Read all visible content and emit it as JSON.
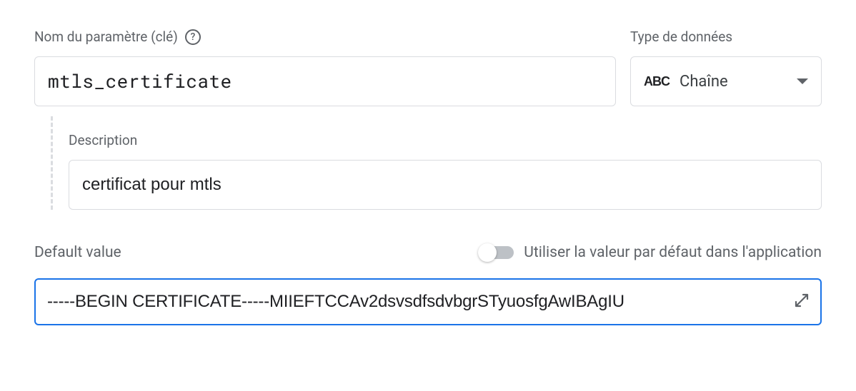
{
  "param": {
    "label": "Nom du paramètre (clé)",
    "value": "mtls_certificate"
  },
  "dataType": {
    "label": "Type de données",
    "iconText": "ABC",
    "selected": "Chaîne"
  },
  "description": {
    "label": "Description",
    "value": "certificat pour mtls"
  },
  "defaultValue": {
    "label": "Default value",
    "toggleLabel": "Utiliser la valeur par défaut dans l'application",
    "value": "-----BEGIN CERTIFICATE-----MIIEFTCCAv2dsvsdfsdvbgrSTyuosfgAwIBAgIU"
  }
}
